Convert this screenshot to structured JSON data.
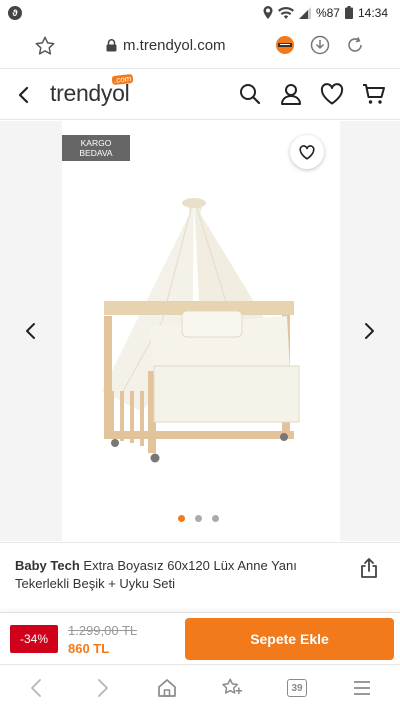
{
  "statusbar": {
    "battery_percent": "%87",
    "time": "14:34"
  },
  "browser": {
    "url": "m.trendyol.com",
    "tabs_count": "39"
  },
  "app": {
    "logo_text": "trendyol",
    "logo_suffix": ".com"
  },
  "gallery": {
    "badge_line1": "KARGO",
    "badge_line2": "BEDAVA",
    "image_count": 3,
    "active_index": 0
  },
  "product": {
    "brand": "Baby Tech",
    "name": "Extra Boyasız 60x120 Lüx Anne Yanı Tekerlekli Beşik + Uyku Seti"
  },
  "pricing": {
    "discount": "-34%",
    "old_price": "1.299,00 TL",
    "new_price": "860 TL",
    "add_to_cart_label": "Sepete Ekle"
  },
  "colors": {
    "accent": "#f27a1a",
    "discount": "#d0021b"
  }
}
